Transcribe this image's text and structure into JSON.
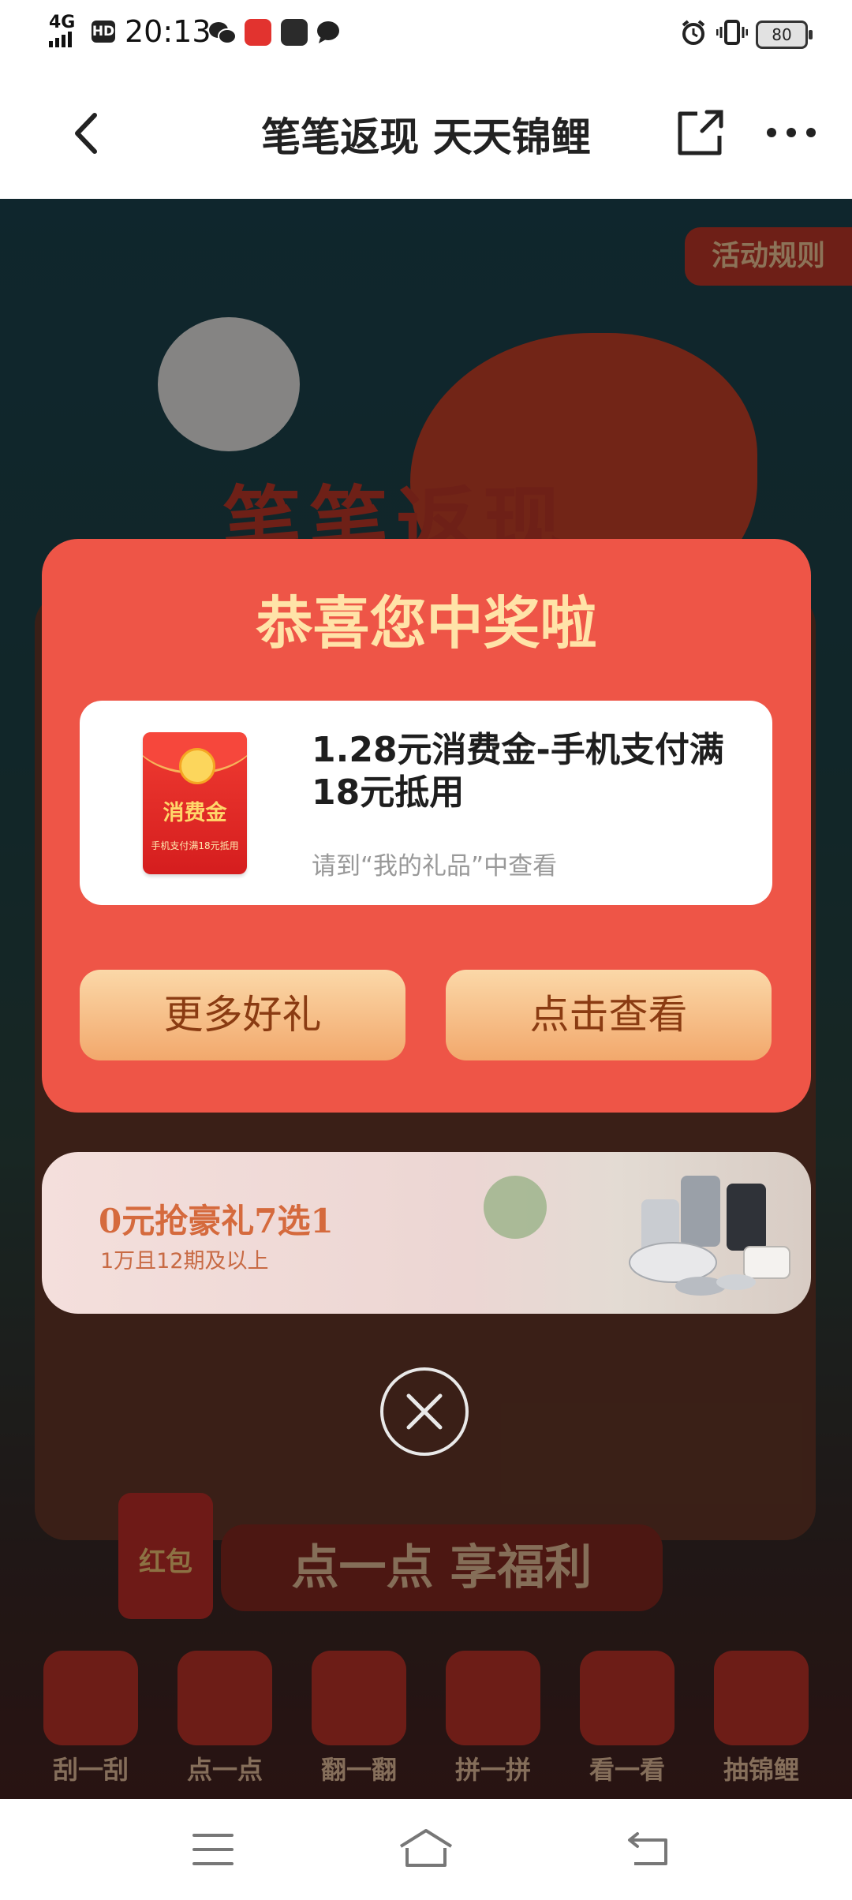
{
  "status_bar": {
    "network": "4G",
    "time": "20:13",
    "battery": "80"
  },
  "header": {
    "title": "笔笔返现 天天锦鲤"
  },
  "background": {
    "rules_tag": "活动规则",
    "banner_text": "笔笔返现",
    "slogan": "点一点 享福利",
    "envelope_text": "红包",
    "tabs": [
      "刮一刮",
      "点一点",
      "翻一翻",
      "拼一拼",
      "看一看",
      "抽锦鲤"
    ]
  },
  "modal": {
    "title": "恭喜您中奖啦",
    "prize_name": "1.28元消费金-手机支付满18元抵用",
    "prize_hint": "请到“我的礼品”中查看",
    "envelope_label": "消费金",
    "envelope_sub": "手机支付满18元抵用",
    "more_button": "更多好礼",
    "view_button": "点击查看"
  },
  "promo": {
    "title": "0元抢豪礼7选1",
    "subtitle": "1万且12期及以上"
  },
  "colors": {
    "modal_bg": "#ee5547",
    "title_text": "#ffe3a8",
    "button_text": "#8a3b12",
    "promo_text": "#d56a3d"
  }
}
